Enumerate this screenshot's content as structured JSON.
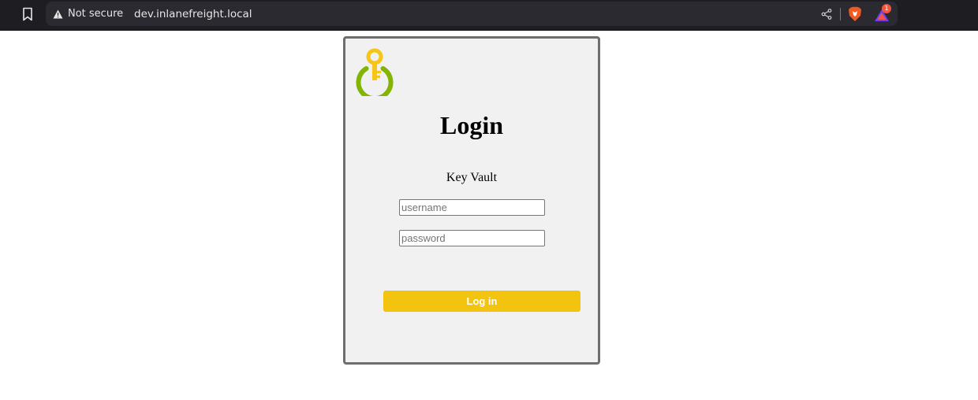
{
  "browser": {
    "security_label": "Not secure",
    "url": "dev.inlanefreight.local",
    "rewards_count": "1",
    "icons": {
      "bookmark": "bookmark-icon",
      "warning": "warning-icon",
      "share": "share-icon",
      "brave": "brave-shields-icon",
      "rewards": "brave-rewards-icon"
    }
  },
  "login": {
    "logo": "key-power-logo",
    "title": "Login",
    "subtitle": "Key Vault",
    "username_placeholder": "username",
    "password_placeholder": "password",
    "submit_label": "Log in"
  },
  "colors": {
    "accent": "#f2c40f",
    "logo_green": "#82b400",
    "logo_yellow": "#f5c518",
    "card_bg": "#f1f1f1",
    "card_border": "#6e6e6e"
  }
}
